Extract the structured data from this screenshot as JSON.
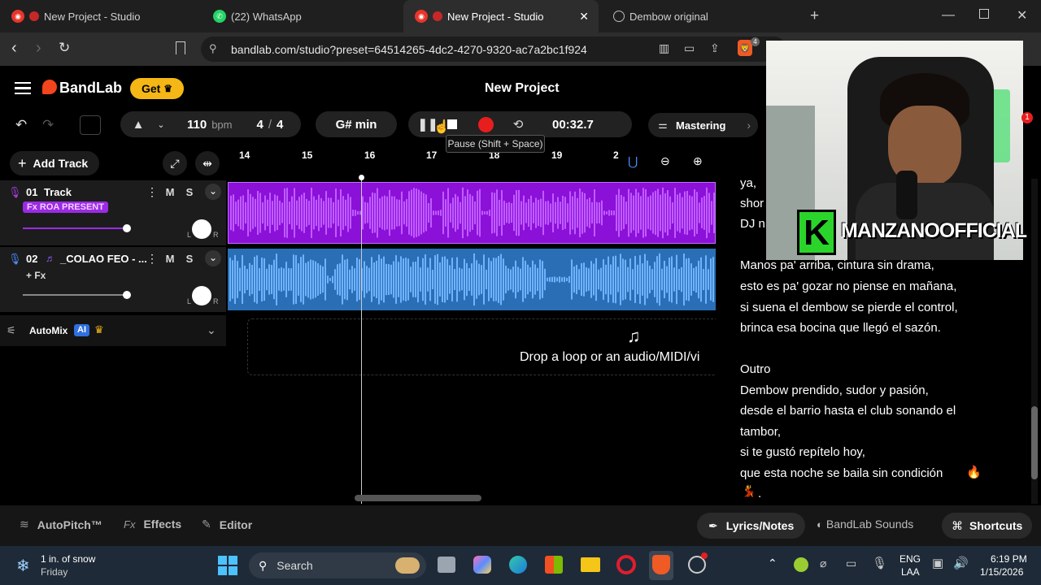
{
  "browser": {
    "tabs": [
      {
        "label": "New Project - Studio"
      },
      {
        "label": "(22) WhatsApp"
      },
      {
        "label": "New Project - Studio",
        "active": true
      },
      {
        "label": "Dembow original"
      }
    ],
    "url": "bandlab.com/studio?preset=64514265-4dc2-4270-9320-ac7a2bc1f924",
    "brave_badge": "4"
  },
  "app": {
    "brand": "BandLab",
    "get_label": "Get",
    "project_title": "New Project",
    "tempo": "110",
    "tempo_unit": "bpm",
    "time_sig_num": "4",
    "time_sig_sep": "/",
    "time_sig_den": "4",
    "key": "G# min",
    "time": "00:32.7",
    "mastering": "Mastering",
    "tooltip": "Pause (Shift + Space)",
    "add_track": "Add Track",
    "ruler": [
      "14",
      "15",
      "16",
      "17",
      "18",
      "19",
      "2"
    ],
    "tracks": [
      {
        "number": "01",
        "name": "Track",
        "fx": "Fx ROA PRESENT"
      },
      {
        "number": "02",
        "name": "_COLAO FEO - ...",
        "fx": "+ Fx"
      }
    ],
    "mute": "M",
    "solo": "S",
    "pan_l": "L",
    "pan_r": "R",
    "automix": "AutoMix",
    "ai_badge": "AI",
    "drop_text": "Drop a loop or an audio/MIDI/vi",
    "bottom": {
      "autopitch": "AutoPitch™",
      "effects": "Effects",
      "fx_prefix": "Fx",
      "editor": "Editor",
      "lyrics": "Lyrics/Notes",
      "sounds": "BandLab Sounds",
      "shortcuts": "Shortcuts"
    }
  },
  "lyrics": {
    "partial": [
      "ya,",
      "shor",
      "DJ n"
    ],
    "verse": [
      "Manos pa' arriba, cintura sin drama,",
      "esto es pa' gozar no piense en mañana,",
      "si suena el dembow se pierde el control,",
      "brinca esa bocina que llegó el sazón."
    ],
    "outro_title": "Outro",
    "outro": [
      "Dembow prendido, sudor y pasión,",
      "desde el barrio hasta el club sonando el",
      "tambor,",
      "si te gustó repítelo hoy,",
      "que esta noche se baila sin condición"
    ],
    "end": "."
  },
  "webcam": {
    "overlay": "MANZANOOFFICIAL",
    "logo": "K"
  },
  "taskbar": {
    "weather_temp": "1 in. of snow",
    "weather_day": "Friday",
    "search": "Search",
    "lang1": "ENG",
    "lang2": "LAA",
    "time": "6:19 PM",
    "date": "1/15/2026"
  },
  "colors": {
    "track1": "#8b10d8",
    "track2": "#2a6fb5",
    "brand": "#f2441d",
    "get": "#f5b716",
    "record": "#e81e1e"
  }
}
